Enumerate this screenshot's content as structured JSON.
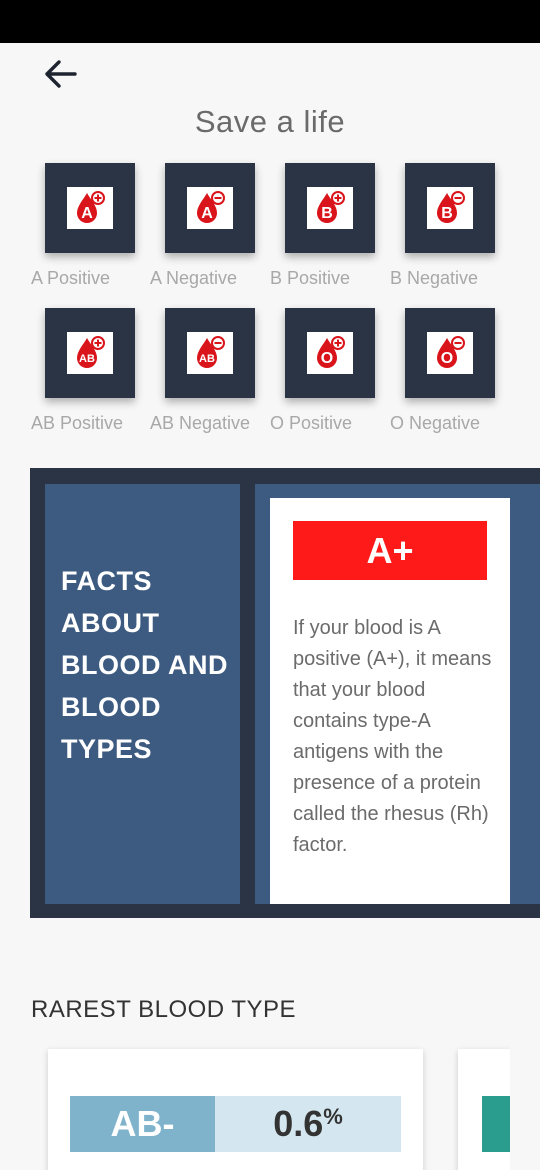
{
  "header": {
    "title": "Save a life",
    "back_icon": "arrow-left-icon"
  },
  "blood_types": [
    {
      "code": "A",
      "sign": "+",
      "label": "A Positive"
    },
    {
      "code": "A",
      "sign": "-",
      "label": "A Negative"
    },
    {
      "code": "B",
      "sign": "+",
      "label": "B Positive"
    },
    {
      "code": "B",
      "sign": "-",
      "label": "B Negative"
    },
    {
      "code": "AB",
      "sign": "+",
      "label": "AB Positive"
    },
    {
      "code": "AB",
      "sign": "-",
      "label": "AB Negative"
    },
    {
      "code": "O",
      "sign": "+",
      "label": "O Positive"
    },
    {
      "code": "O",
      "sign": "-",
      "label": "O Negative"
    }
  ],
  "facts": {
    "title": "FACTS ABOUT BLOOD AND BLOOD TYPES",
    "card": {
      "type": "A+",
      "text": "If your blood is A positive (A+), it means that your blood contains type-A antigens with the presence of a protein called the rhesus (Rh) factor."
    }
  },
  "rarest": {
    "title": "RAREST BLOOD TYPE",
    "type": "AB-",
    "percent": "0.6",
    "percent_sign": "%"
  },
  "colors": {
    "tile": "#2b3445",
    "drop": "#d9151b",
    "banner": "#ff1a1a",
    "facts_bg": "#3d5a80",
    "rare_type_bg": "#7fb3cc",
    "rare_pct_bg": "#d4e6ef",
    "accent_teal": "#2a9d8f"
  }
}
